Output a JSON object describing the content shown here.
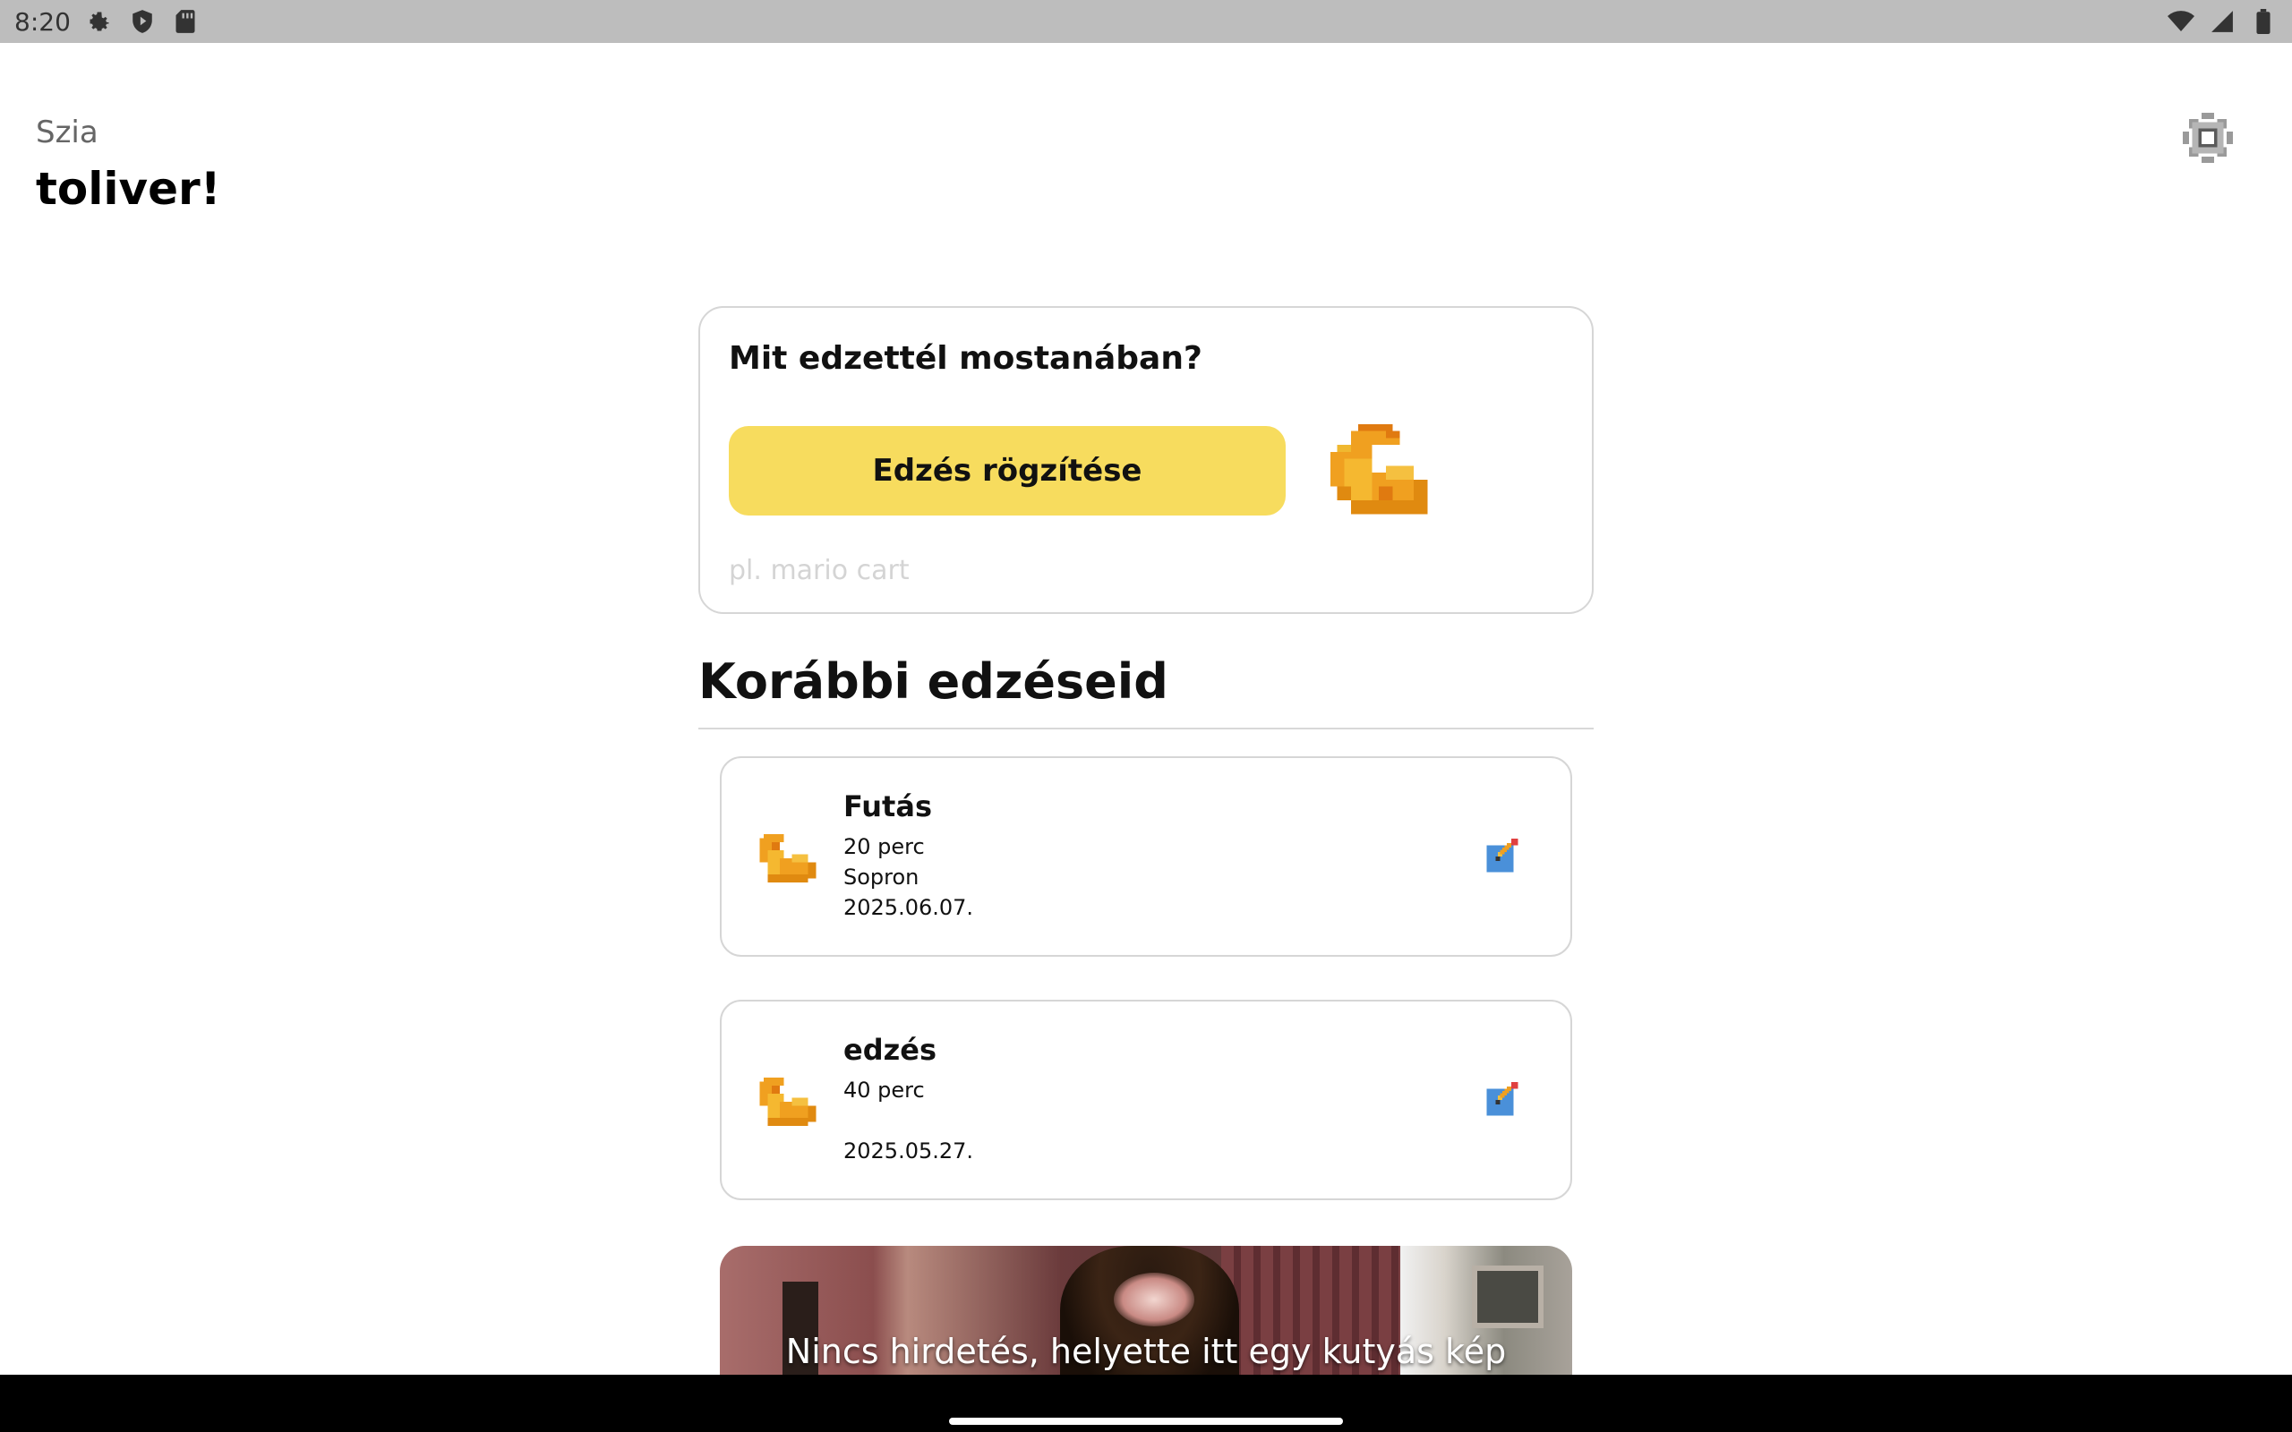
{
  "status_bar": {
    "time": "8:20",
    "left_icons": [
      "gear-icon",
      "play-protect-icon",
      "sd-card-icon"
    ],
    "right_icons": [
      "wifi-icon",
      "signal-icon",
      "battery-icon"
    ]
  },
  "header": {
    "greeting": "Szia",
    "username": "toliver!",
    "settings_icon": "gear-icon"
  },
  "record": {
    "title": "Mit edzettél mostanában?",
    "button_label": "Edzés rögzítése",
    "input_placeholder": "pl. mario cart",
    "input_value": "",
    "icon": "flexed-biceps-icon"
  },
  "history": {
    "title": "Korábbi edzéseid",
    "items": [
      {
        "name": "Futás",
        "duration": "20 perc",
        "location": "Sopron",
        "date": "2025.06.07.",
        "icon": "flexed-biceps-icon",
        "edit_icon": "edit-pencil-icon"
      },
      {
        "name": "edzés",
        "duration": "40 perc",
        "location": "",
        "date": "2025.05.27.",
        "icon": "flexed-biceps-icon",
        "edit_icon": "edit-pencil-icon"
      }
    ]
  },
  "ad": {
    "caption": "Nincs hirdetés, helyette itt egy kutyás kép"
  },
  "colors": {
    "accent_button": "#f7dc5e",
    "biceps": "#f0a020",
    "edit_icon": "#4a90d9"
  }
}
